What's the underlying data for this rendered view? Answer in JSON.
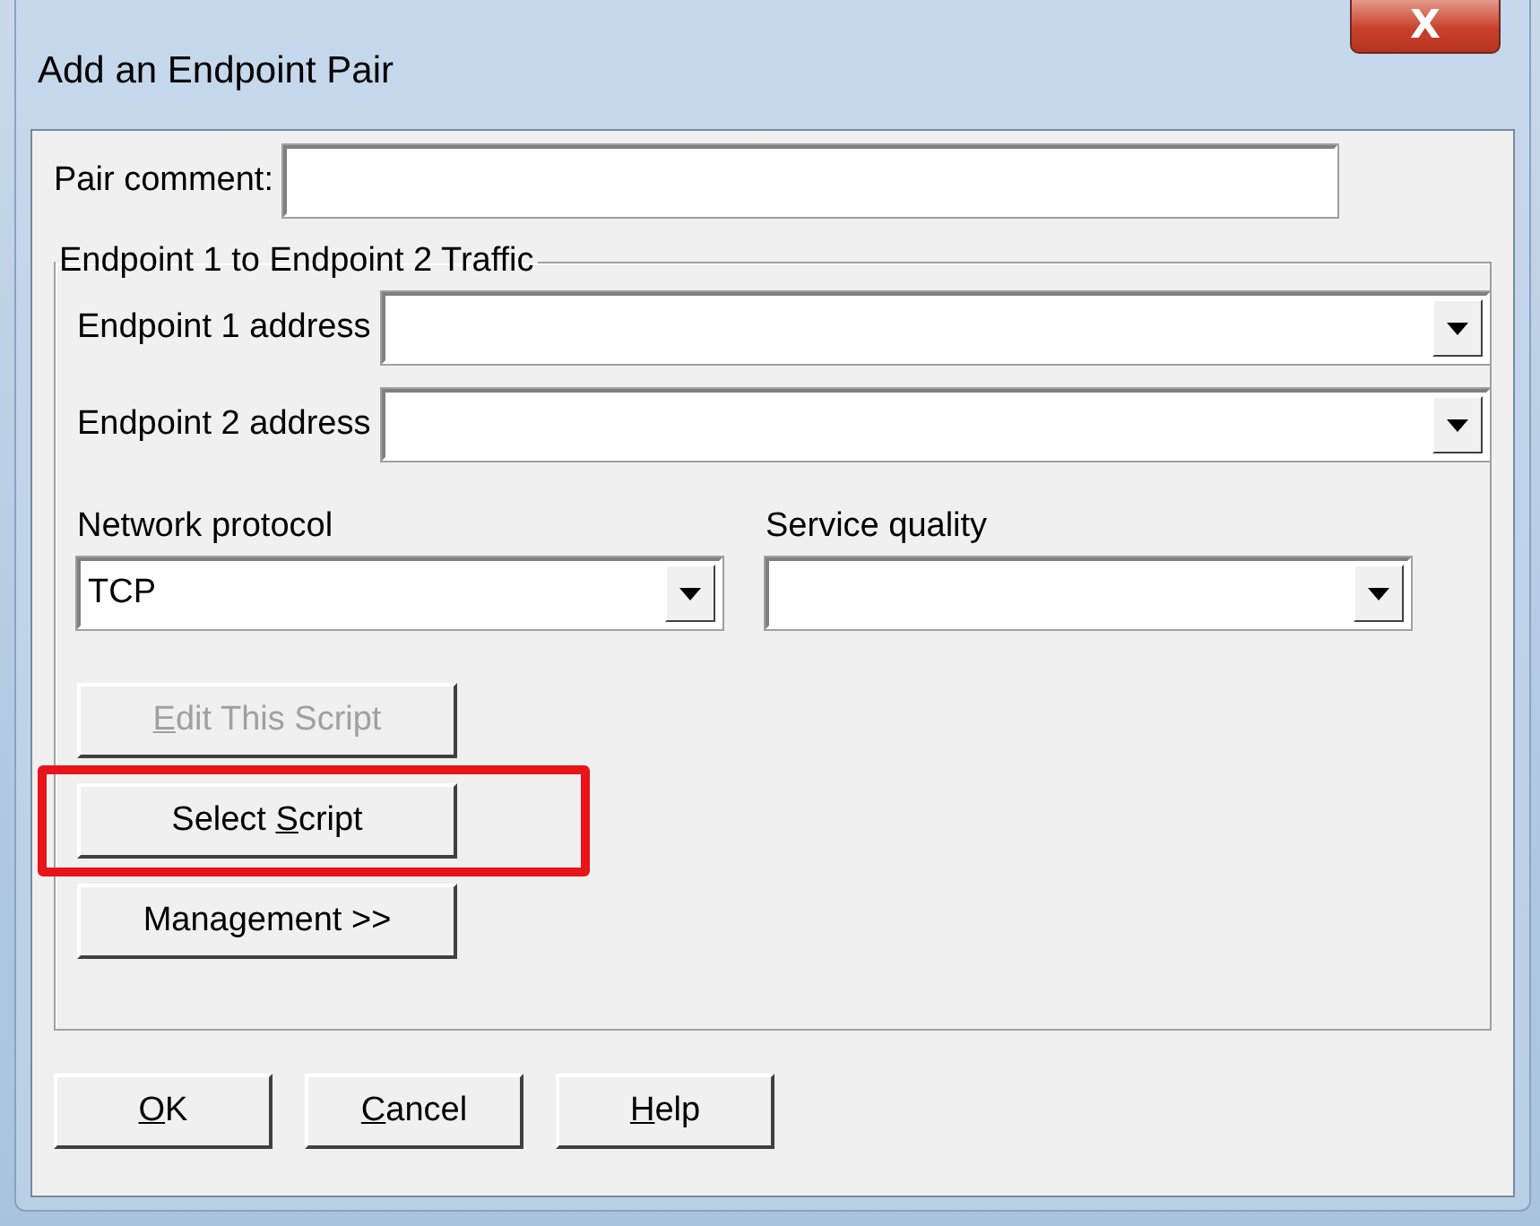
{
  "window": {
    "title": "Add an Endpoint Pair",
    "close_label": "X"
  },
  "pair_comment": {
    "label": "Pair comment:"
  },
  "group": {
    "title": "Endpoint 1 to Endpoint 2 Traffic",
    "addresses": [
      {
        "label": "Endpoint 1 address"
      },
      {
        "label": "Endpoint 2 address"
      }
    ],
    "network_protocol": {
      "label": "Network protocol",
      "value": "TCP"
    },
    "service_quality": {
      "label": "Service quality"
    },
    "script_buttons": [
      {
        "key": "E",
        "after": "dit This Script",
        "disabled": true,
        "highlighted": false
      },
      {
        "before": "Select ",
        "key": "S",
        "after": "cript",
        "disabled": false,
        "highlighted": true
      },
      {
        "before": "Management >>",
        "disabled": false,
        "highlighted": false
      }
    ]
  },
  "buttons": [
    {
      "key": "O",
      "after": "K"
    },
    {
      "key": "C",
      "after": "ancel"
    },
    {
      "key": "H",
      "after": "elp"
    }
  ]
}
